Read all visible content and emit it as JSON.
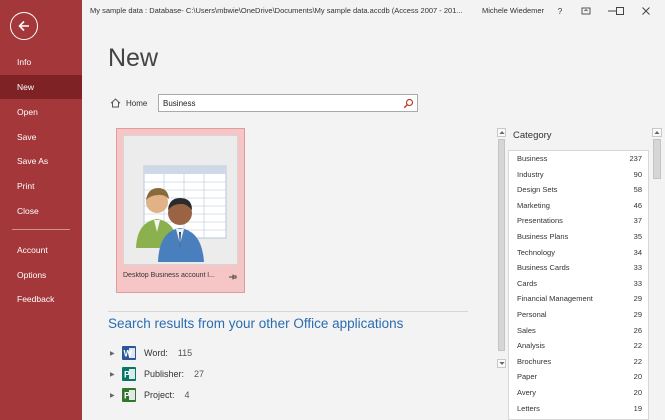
{
  "window": {
    "title": "My sample data : Database- C:\\Users\\mbwie\\OneDrive\\Documents\\My sample data.accdb (Access 2007 - 201...",
    "user": "Michele Wiedemer",
    "help": "?"
  },
  "nav": {
    "items": [
      {
        "label": "Info"
      },
      {
        "label": "New",
        "active": true
      },
      {
        "label": "Open"
      },
      {
        "label": "Save"
      },
      {
        "label": "Save As"
      },
      {
        "label": "Print"
      },
      {
        "label": "Close"
      },
      {
        "label": "Account"
      },
      {
        "label": "Options"
      },
      {
        "label": "Feedback"
      }
    ]
  },
  "main": {
    "title": "New",
    "home_label": "Home",
    "search_value": "Business"
  },
  "template": {
    "label": "Desktop Business account l..."
  },
  "other_office": {
    "heading": "Search results from your other Office applications",
    "apps": [
      {
        "name": "Word:",
        "count": "115",
        "icon": "word-icon",
        "color": "#2b579a",
        "letter": "W"
      },
      {
        "name": "Publisher:",
        "count": "27",
        "icon": "publisher-icon",
        "color": "#077568",
        "letter": "P"
      },
      {
        "name": "Project:",
        "count": "4",
        "icon": "project-icon",
        "color": "#31752f",
        "letter": "P"
      }
    ]
  },
  "category": {
    "heading": "Category",
    "items": [
      {
        "name": "Business",
        "count": "237"
      },
      {
        "name": "Industry",
        "count": "90"
      },
      {
        "name": "Design Sets",
        "count": "58"
      },
      {
        "name": "Marketing",
        "count": "46"
      },
      {
        "name": "Presentations",
        "count": "37"
      },
      {
        "name": "Business Plans",
        "count": "35"
      },
      {
        "name": "Technology",
        "count": "34"
      },
      {
        "name": "Business Cards",
        "count": "33"
      },
      {
        "name": "Cards",
        "count": "33"
      },
      {
        "name": "Financial Management",
        "count": "29"
      },
      {
        "name": "Personal",
        "count": "29"
      },
      {
        "name": "Sales",
        "count": "26"
      },
      {
        "name": "Analysis",
        "count": "22"
      },
      {
        "name": "Brochures",
        "count": "22"
      },
      {
        "name": "Paper",
        "count": "20"
      },
      {
        "name": "Avery",
        "count": "20"
      },
      {
        "name": "Letters",
        "count": "19"
      }
    ]
  },
  "colors": {
    "accent": "#a4373a",
    "accent_dark": "#7f2225",
    "link": "#2b6cb0",
    "tile_bg": "#f6c6c6"
  }
}
